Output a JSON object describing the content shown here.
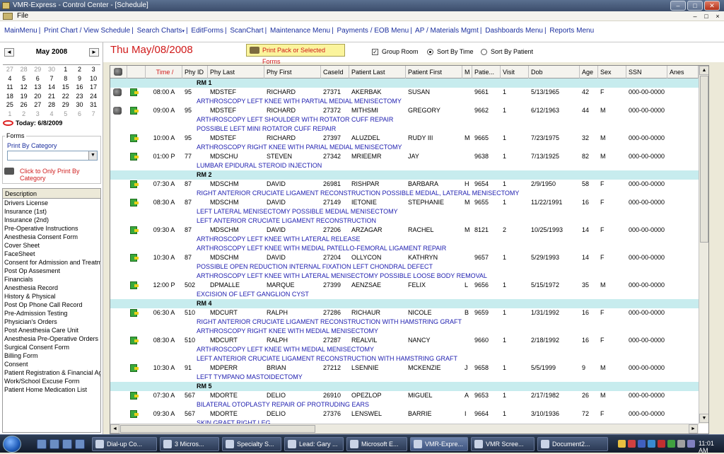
{
  "titlebar": {
    "title": "VMR-Express - Control Center - [Schedule]"
  },
  "menubar": {
    "file": "File"
  },
  "nav": [
    "MainMenu",
    "Print Chart / View Schedule",
    "Search Charts",
    "EditForms",
    "ScanChart",
    "Maintenance Menu",
    "Payments / EOB Menu",
    "AP / Materials Mgmt",
    "Dashboards Menu",
    "Reports Menu"
  ],
  "calendar": {
    "month": "May 2008",
    "prev": "◄",
    "next": "►",
    "weeks": [
      [
        "27",
        "28",
        "29",
        "30",
        "1",
        "2",
        "3"
      ],
      [
        "4",
        "5",
        "6",
        "7",
        "8",
        "9",
        "10"
      ],
      [
        "11",
        "12",
        "13",
        "14",
        "15",
        "16",
        "17"
      ],
      [
        "18",
        "19",
        "20",
        "21",
        "22",
        "23",
        "24"
      ],
      [
        "25",
        "26",
        "27",
        "28",
        "29",
        "30",
        "31"
      ],
      [
        "1",
        "2",
        "3",
        "4",
        "5",
        "6",
        "7"
      ]
    ],
    "today": "Today: 6/8/2009"
  },
  "forms": {
    "label": "Forms",
    "print_by_category": "Print By Category",
    "click_print": "Click to Only Print By Category"
  },
  "description": {
    "header": "Description",
    "items": [
      "Drivers License",
      "Insurance (1st)",
      "Insurance (2nd)",
      "Pre-Operative Instructions",
      "Anesthesia Consent Form",
      "Cover Sheet",
      "FaceSheet",
      "Consent for Admission and Treatmer",
      "Post Op Assesment",
      "Financials",
      "Anesthesia Record",
      "History & Physical",
      "Post Op Phone Call Record",
      "Pre-Admission Testing",
      "Physician's Orders",
      "Post Anesthesia Care Unit",
      "Anesthesia Pre-Operative Orders",
      "Surgical Consent Form",
      "Billing Form",
      "Consent",
      "Patient Registration & Financial Agre",
      "Work/School Excuse Form",
      "Patient Home Medication List"
    ]
  },
  "top": {
    "date_title": "Thu May/08/2008",
    "print_pack": "Print Pack or Selected Forms",
    "group_room": "Group Room",
    "sort_time": "Sort By Time",
    "sort_patient": "Sort By Patient"
  },
  "grid": {
    "headers": [
      "Time /",
      "Phy ID",
      "Phy Last",
      "Phy First",
      "CaseId",
      "Patient Last",
      "Patient First",
      "M",
      "Patie...",
      "Visit",
      "Dob",
      "Age",
      "Sex",
      "SSN",
      "Anes"
    ],
    "rows": [
      {
        "type": "room",
        "text": "RM 1"
      },
      {
        "type": "data",
        "sun": true,
        "time": "08:00 A",
        "phyid": "95",
        "phylast": "MDSTEF",
        "phyfirst": "RICHARD",
        "caseid": "27371",
        "plast": "AKERBAK",
        "pfirst": "SUSAN",
        "m": "",
        "pid": "9661",
        "visit": "1",
        "dob": "5/13/1965",
        "age": "42",
        "sex": "F",
        "ssn": "000-00-0000"
      },
      {
        "type": "proc",
        "text": "ARTHROSCOPY LEFT KNEE WITH PARTIAL MEDIAL MENISECTOMY"
      },
      {
        "type": "data",
        "sun": true,
        "time": "09:00 A",
        "phyid": "95",
        "phylast": "MDSTEF",
        "phyfirst": "RICHARD",
        "caseid": "27372",
        "plast": "MITHSMI",
        "pfirst": "GREGORY",
        "m": "",
        "pid": "9662",
        "visit": "1",
        "dob": "6/12/1963",
        "age": "44",
        "sex": "M",
        "ssn": "000-00-0000"
      },
      {
        "type": "proc",
        "text": "ARTHROSCOPY LEFT SHOULDER WITH ROTATOR CUFF REPAIR"
      },
      {
        "type": "proc",
        "text": "POSSIBLE LEFT MINI ROTATOR CUFF REPAIR"
      },
      {
        "type": "data",
        "sun": false,
        "time": "10:00 A",
        "phyid": "95",
        "phylast": "MDSTEF",
        "phyfirst": "RICHARD",
        "caseid": "27397",
        "plast": "ALUZDEL",
        "pfirst": "RUDY III",
        "m": "M",
        "pid": "9665",
        "visit": "1",
        "dob": "7/23/1975",
        "age": "32",
        "sex": "M",
        "ssn": "000-00-0000"
      },
      {
        "type": "proc",
        "text": "ARTHROSCOPY RIGHT KNEE WITH PARIAL MEDIAL MENISECTOMY"
      },
      {
        "type": "data",
        "sun": false,
        "time": "01:00 P",
        "phyid": "77",
        "phylast": "MDSCHU",
        "phyfirst": "STEVEN",
        "caseid": "27342",
        "plast": "MRIEEMR",
        "pfirst": "JAY",
        "m": "",
        "pid": "9638",
        "visit": "1",
        "dob": "7/13/1925",
        "age": "82",
        "sex": "M",
        "ssn": "000-00-0000"
      },
      {
        "type": "proc",
        "text": "LUMBAR EPIDURAL STEROID  INJECTION"
      },
      {
        "type": "room",
        "text": "RM 2"
      },
      {
        "type": "data",
        "sun": false,
        "time": "07:30 A",
        "phyid": "87",
        "phylast": "MDSCHM",
        "phyfirst": "DAVID",
        "caseid": "26981",
        "plast": "RISHPAR",
        "pfirst": "BARBARA",
        "m": "H",
        "pid": "9654",
        "visit": "1",
        "dob": "2/9/1950",
        "age": "58",
        "sex": "F",
        "ssn": "000-00-0000"
      },
      {
        "type": "proc",
        "text": "RIGHT ANTERIOR CRUCIATE LIGAMENT RECONSTRUCTION POSSIBLE MEDIAL, LATERAL MENISECTOMY"
      },
      {
        "type": "data",
        "sun": false,
        "time": "08:30 A",
        "phyid": "87",
        "phylast": "MDSCHM",
        "phyfirst": "DAVID",
        "caseid": "27149",
        "plast": "IETONIE",
        "pfirst": "STEPHANIE",
        "m": "M",
        "pid": "9655",
        "visit": "1",
        "dob": "11/22/1991",
        "age": "16",
        "sex": "F",
        "ssn": "000-00-0000"
      },
      {
        "type": "proc",
        "text": "LEFT LATERAL MENISECTOMY POSSIBLE MEDIAL MENISECTOMY"
      },
      {
        "type": "proc",
        "text": "LEFT ANTERIOR CRUCIATE LIGAMENT RECONSTRUCTION"
      },
      {
        "type": "data",
        "sun": false,
        "time": "09:30 A",
        "phyid": "87",
        "phylast": "MDSCHM",
        "phyfirst": "DAVID",
        "caseid": "27206",
        "plast": "ARZAGAR",
        "pfirst": "RACHEL",
        "m": "M",
        "pid": "8121",
        "visit": "2",
        "dob": "10/25/1993",
        "age": "14",
        "sex": "F",
        "ssn": "000-00-0000"
      },
      {
        "type": "proc",
        "text": "ARTHROSCOPY LEFT KNEE WITH LATERAL  RELEASE"
      },
      {
        "type": "proc",
        "text": "ARTHROSCOPY LEFT KNEE WITH MEDIAL PATELLO-FEMORAL LIGAMENT REPAIR"
      },
      {
        "type": "data",
        "sun": false,
        "time": "10:30 A",
        "phyid": "87",
        "phylast": "MDSCHM",
        "phyfirst": "DAVID",
        "caseid": "27204",
        "plast": "OLLYCON",
        "pfirst": "KATHRYN",
        "m": "",
        "pid": "9657",
        "visit": "1",
        "dob": "5/29/1993",
        "age": "14",
        "sex": "F",
        "ssn": "000-00-0000"
      },
      {
        "type": "proc",
        "text": "POSSIBLE OPEN REDUCTION INTERNAL FIXATION LEFT CHONDRAL DEFECT"
      },
      {
        "type": "proc",
        "text": "ARTHROSCOPY LEFT KNEE WITH LATERAL MENISECTOMY POSSIBLE LOOSE BODY REMOVAL"
      },
      {
        "type": "data",
        "sun": false,
        "time": "12:00 P",
        "phyid": "502",
        "phylast": "DPMALLE",
        "phyfirst": "MARQUE",
        "caseid": "27399",
        "plast": "AENZSAE",
        "pfirst": "FELIX",
        "m": "L",
        "pid": "9656",
        "visit": "1",
        "dob": "5/15/1972",
        "age": "35",
        "sex": "M",
        "ssn": "000-00-0000"
      },
      {
        "type": "proc",
        "text": "EXCISION OF LEFT GANGLION CYST"
      },
      {
        "type": "room",
        "text": "RM 4"
      },
      {
        "type": "data",
        "sun": false,
        "time": "06:30 A",
        "phyid": "510",
        "phylast": "MDCURT",
        "phyfirst": "RALPH",
        "caseid": "27286",
        "plast": "RICHAUR",
        "pfirst": "NICOLE",
        "m": "B",
        "pid": "9659",
        "visit": "1",
        "dob": "1/31/1992",
        "age": "16",
        "sex": "F",
        "ssn": "000-00-0000"
      },
      {
        "type": "proc",
        "text": "RIGHT ANTERIOR CRUCIATE LIGAMENT RECONSTRUCTION WITH HAMSTRING GRAFT"
      },
      {
        "type": "proc",
        "text": "ARTHROSCOPY RIGHT KNEE WITH MEDIAL MENISECTOMY"
      },
      {
        "type": "data",
        "sun": false,
        "time": "08:30 A",
        "phyid": "510",
        "phylast": "MDCURT",
        "phyfirst": "RALPH",
        "caseid": "27287",
        "plast": "REALVIL",
        "pfirst": "NANCY",
        "m": "",
        "pid": "9660",
        "visit": "1",
        "dob": "2/18/1992",
        "age": "16",
        "sex": "F",
        "ssn": "000-00-0000"
      },
      {
        "type": "proc",
        "text": "ARTHROSCOPY LEFT KNEE WITH MEDIAL  MENISECTOMY"
      },
      {
        "type": "proc",
        "text": "LEFT ANTERIOR CRUCIATE LIGAMENT RECONSTRUCTION WITH HAMSTRING GRAFT"
      },
      {
        "type": "data",
        "sun": false,
        "time": "10:30 A",
        "phyid": "91",
        "phylast": "MDPERR",
        "phyfirst": "BRIAN",
        "caseid": "27212",
        "plast": "LSENNIE",
        "pfirst": "MCKENZIE",
        "m": "J",
        "pid": "9658",
        "visit": "1",
        "dob": "5/5/1999",
        "age": "9",
        "sex": "M",
        "ssn": "000-00-0000"
      },
      {
        "type": "proc",
        "text": "LEFT TYMPANO MASTOIDECTOMY"
      },
      {
        "type": "room",
        "text": "RM 5"
      },
      {
        "type": "data",
        "sun": false,
        "time": "07:30 A",
        "phyid": "567",
        "phylast": "MDORTE",
        "phyfirst": "DELIO",
        "caseid": "26910",
        "plast": "OPEZLOP",
        "pfirst": "MIGUEL",
        "m": "A",
        "pid": "9653",
        "visit": "1",
        "dob": "2/17/1982",
        "age": "26",
        "sex": "M",
        "ssn": "000-00-0000"
      },
      {
        "type": "proc",
        "text": "BILATERAL OTOPLASTY REPAIR OF PROTRUDING EARS"
      },
      {
        "type": "data",
        "sun": false,
        "time": "09:30 A",
        "phyid": "567",
        "phylast": "MDORTE",
        "phyfirst": "DELIO",
        "caseid": "27376",
        "plast": "LENSWEL",
        "pfirst": "BARRIE",
        "m": "I",
        "pid": "9664",
        "visit": "1",
        "dob": "3/10/1936",
        "age": "72",
        "sex": "F",
        "ssn": "000-00-0000"
      },
      {
        "type": "proc",
        "text": "SKIN GRAFT RIGHT LEG"
      }
    ]
  },
  "taskbar": {
    "items": [
      "Dial-up Co...",
      "3 Micros...",
      "Specialty S...",
      "Lead: Gary ...",
      "Microsoft E...",
      "VMR-Expre...",
      "VMR Scree...",
      "Document2..."
    ],
    "time": "11:01 AM"
  }
}
